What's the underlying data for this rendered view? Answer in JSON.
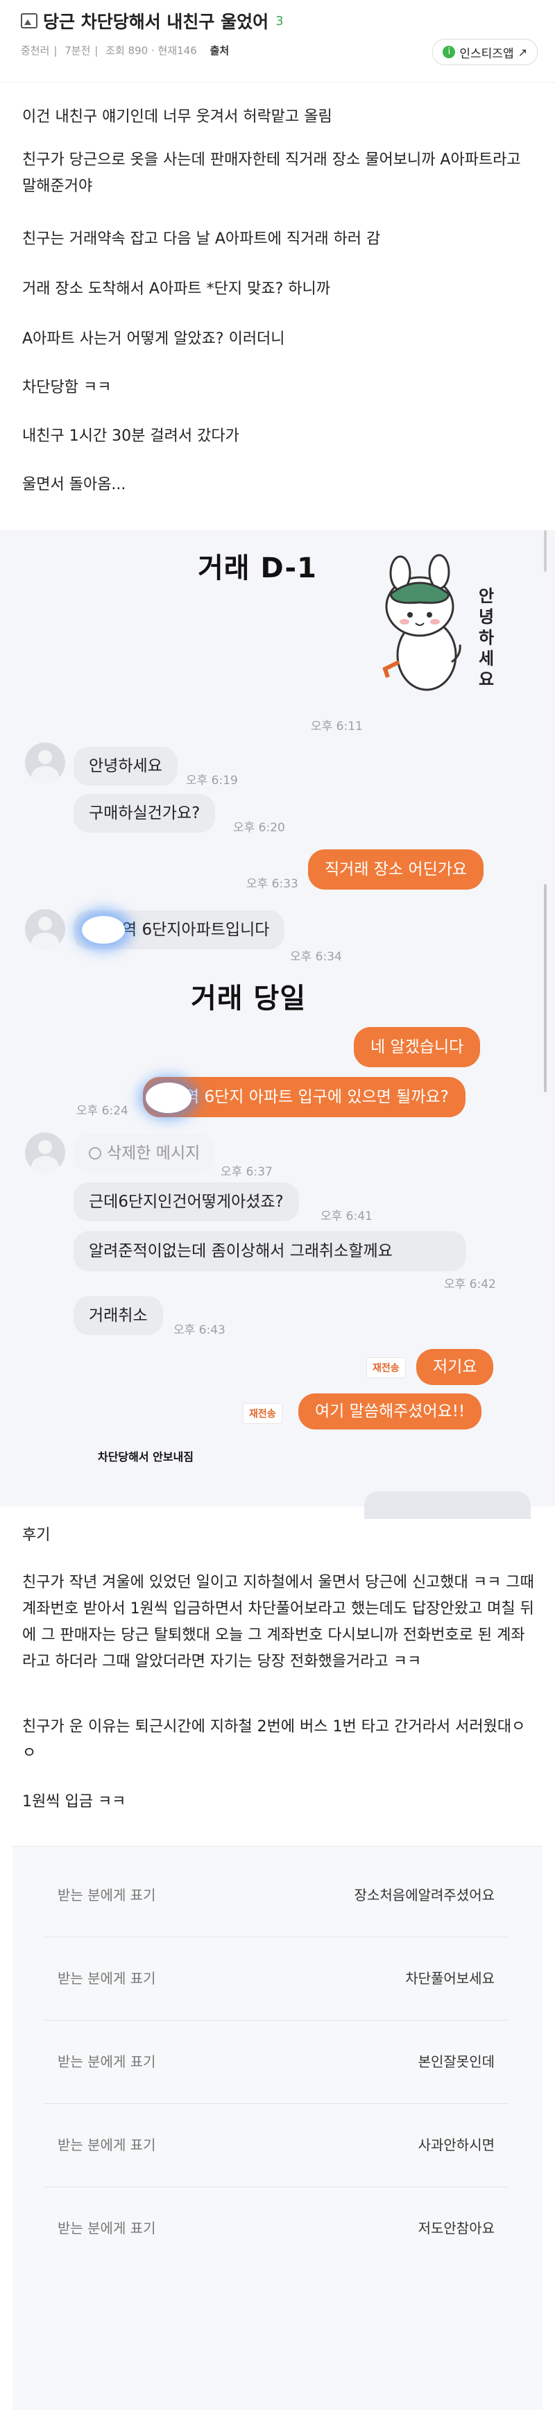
{
  "header": {
    "title": "당근 차단당해서 내친구 울었어",
    "comment_count": "3",
    "author": "중천러",
    "time": "7분전",
    "views": "조회 890 · 현재146",
    "source_label": "출처",
    "source_button": "인스티즈앱"
  },
  "body": {
    "paragraphs": [
      "이건 내친구 얘기인데 너무 웃겨서 허락맡고 올림",
      "친구가 당근으로 옷을 사는데 판매자한테 직거래 장소 물어보니까 A아파트라고 말해준거야",
      "친구는 거래약속 잡고 다음 날 A아파트에 직거래 하러 감",
      "거래 장소 도착해서 A아파트 *단지 맞죠? 하니까",
      "A아파트 사는거 어떻게 알았죠? 이러더니",
      "차단당함 ㅋㅋ",
      "내친구 1시간 30분 걸려서 갔다가",
      "울면서 돌아옴..."
    ]
  },
  "chat": {
    "title_day_before": "거래 D-1",
    "title_day_of": "거래 당일",
    "sticker_text": "안녕하세요",
    "messages": {
      "t_611": "오후 6:11",
      "m1": "안녕하세요",
      "t_619": "오후 6:19",
      "m2": "구매하실건가요?",
      "t_620": "오후 6:20",
      "t_633": "오후 6:33",
      "m3": "직거래 장소 어딘가요",
      "m4": "역 6단지아파트입니다",
      "t_634": "오후 6:34",
      "m5": "네 알겠습니다",
      "m6": "역 6단지 아파트 입구에 있으면 될까요?",
      "t_624": "오후 6:24",
      "m7": "삭제한 메시지",
      "t_637": "오후 6:37",
      "m8": "근데6단지인건어떻게아셨죠?",
      "t_641": "오후 6:41",
      "m9": "알려준적이없는데  좀이상해서 그래취소할께요",
      "t_642": "오후 6:42",
      "m10": "거래취소",
      "t_643": "오후 6:43",
      "resend": "재전송",
      "m11": "저기요",
      "m12": "여기 말씀해주셨어요!!",
      "caption": "차단당해서 안보내짐"
    },
    "accent_color": "#f07a3a"
  },
  "afterword": {
    "label": "후기",
    "p1": "친구가 작년 겨울에 있었던 일이고 지하철에서 울면서 당근에 신고했대 ㅋㅋ 그때 계좌번호 받아서 1원씩 입금하면서 차단풀어보라고 했는데도 답장안왔고 며칠 뒤에 그 판매자는 당근 탈퇴했대 오늘 그 계좌번호 다시보니까 전화번호로 된 계좌라고 하더라 그때 알았더라면 자기는 당장 전화했을거라고 ㅋㅋ",
    "p2": "친구가 운 이유는 퇴근시간에 지하철 2번에 버스 1번 타고 간거라서 서러웠대ㅇㅇ",
    "p3": "1원씩 입금 ㅋㅋ"
  },
  "deposits": {
    "label": "받는 분에게 표기",
    "rows": [
      "장소처음에알려주셨어요",
      "차단풀어보세요",
      "본인잘못인데",
      "사과안하시면",
      "저도안참아요"
    ]
  }
}
